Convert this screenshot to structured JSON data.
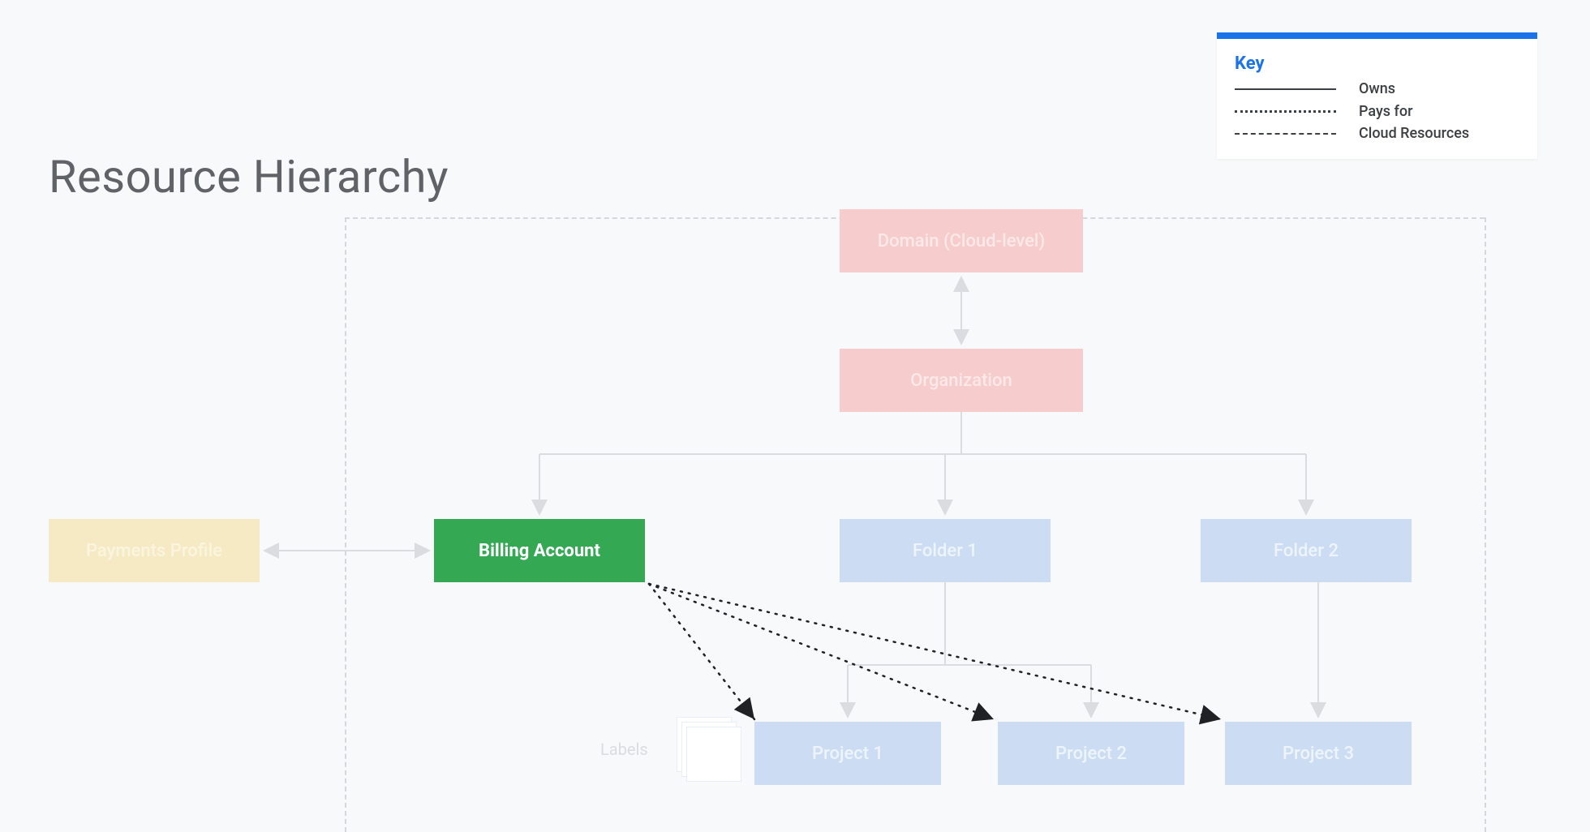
{
  "title": "Resource Hierarchy",
  "legend": {
    "heading": "Key",
    "items": [
      {
        "label": "Owns",
        "style": "solid"
      },
      {
        "label": "Pays for",
        "style": "dotted"
      },
      {
        "label": "Cloud Resources",
        "style": "dashed"
      }
    ]
  },
  "nodes": {
    "domain": {
      "label": "Domain (Cloud-level)"
    },
    "org": {
      "label": "Organization"
    },
    "payments": {
      "label": "Payments Profile"
    },
    "billing": {
      "label": "Billing Account"
    },
    "folder1": {
      "label": "Folder 1"
    },
    "folder2": {
      "label": "Folder 2"
    },
    "project1": {
      "label": "Project 1"
    },
    "project2": {
      "label": "Project 2"
    },
    "project3": {
      "label": "Project 3"
    },
    "labels": {
      "label": "Labels"
    }
  },
  "diagram": {
    "highlighted_node": "billing",
    "relations": [
      {
        "type": "owns-bidir",
        "from": "domain",
        "to": "org"
      },
      {
        "type": "owns",
        "from": "org",
        "to": "billing"
      },
      {
        "type": "owns",
        "from": "org",
        "to": "folder1"
      },
      {
        "type": "owns",
        "from": "org",
        "to": "folder2"
      },
      {
        "type": "owns-bidir",
        "from": "payments",
        "to": "billing"
      },
      {
        "type": "owns",
        "from": "folder1",
        "to": "project1"
      },
      {
        "type": "owns",
        "from": "folder1",
        "to": "project2"
      },
      {
        "type": "owns",
        "from": "folder2",
        "to": "project3"
      },
      {
        "type": "pays-for",
        "from": "billing",
        "to": "project1"
      },
      {
        "type": "pays-for",
        "from": "billing",
        "to": "project2"
      },
      {
        "type": "pays-for",
        "from": "billing",
        "to": "project3"
      }
    ]
  },
  "colors": {
    "ghost_pink": "#f6cccc",
    "ghost_blue": "#ccdcf3",
    "ghost_yellow": "#f5eac4",
    "active_green": "#34a853",
    "accent_blue": "#1a73e8",
    "line_gray": "#dadce0",
    "title_gray": "#5f6368"
  }
}
